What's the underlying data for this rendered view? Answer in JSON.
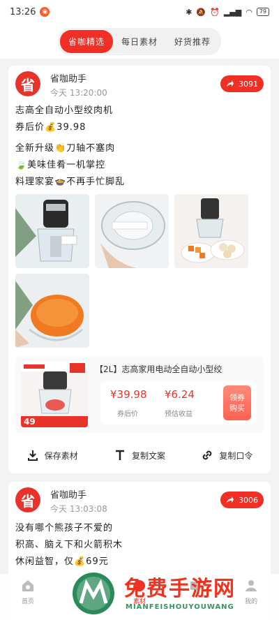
{
  "status": {
    "time": "13:26",
    "battery": "79"
  },
  "tabs": [
    {
      "label": "省咖精选"
    },
    {
      "label": "每日素材"
    },
    {
      "label": "好货推荐"
    }
  ],
  "post1": {
    "author": "省咖助手",
    "time": "今天 13:20:00",
    "share_count": "3091",
    "lines": [
      "志高全自动小型绞肉机",
      "券后价💰39.98",
      "全新升级👏刀轴不塞肉",
      "🍃美味佳肴一机掌控",
      "料理家宴🍲不再手忙脚乱"
    ],
    "product": {
      "title": "【2L】志高家用电动全自动小型绞",
      "price_after": "¥39.98",
      "price_after_label": "券后价",
      "income": "¥6.24",
      "income_label": "预估收益",
      "coupon": [
        "领券",
        "购买"
      ],
      "badge": "49"
    },
    "actions": [
      {
        "label": "保存素材",
        "icon": "download-icon"
      },
      {
        "label": "复制文案",
        "icon": "text-icon"
      },
      {
        "label": "复制口令",
        "icon": "link-icon"
      }
    ]
  },
  "post2": {
    "author": "省咖助手",
    "time": "今天 13:03:08",
    "share_count": "3006",
    "lines": [
      "没有哪个熊孩子不爱的",
      "积高、脑え下和火箭积木",
      "休闲益智，仅💰69元"
    ]
  },
  "nav": [
    {
      "label": "首页",
      "icon": "home-icon"
    },
    {
      "label": "",
      "icon": "category-icon"
    },
    {
      "label": "素材",
      "icon": "material-icon"
    },
    {
      "label": "",
      "icon": "cart-icon"
    },
    {
      "label": "我的",
      "icon": "user-icon"
    }
  ],
  "watermark": {
    "title": "免费手游网",
    "sub": "MIANFEISHOUYOUWANG"
  },
  "colors": {
    "accent": "#f22f24",
    "bg": "#f3f3f3"
  }
}
